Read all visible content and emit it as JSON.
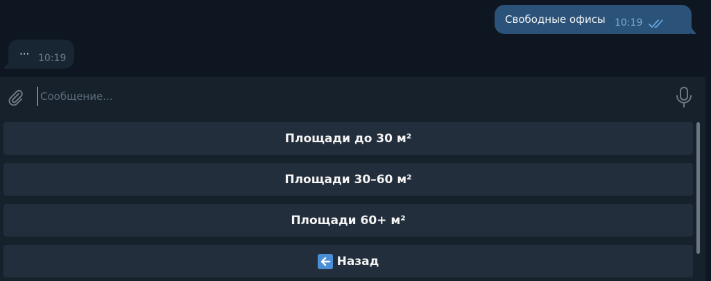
{
  "messages": {
    "outgoing": {
      "text": "Свободные офисы",
      "time": "10:19",
      "status_icon": "double-check-icon"
    },
    "incoming": {
      "text": "···",
      "time": "10:19"
    }
  },
  "composer": {
    "placeholder": "Сообщение...",
    "value": "",
    "attach_icon": "paperclip-icon",
    "mic_icon": "microphone-icon"
  },
  "keyboard": {
    "buttons": [
      {
        "label": "Площади до 30 м²"
      },
      {
        "label": "Площади 30–60 м²"
      },
      {
        "label": "Площади 60+ м²"
      },
      {
        "label": "Назад",
        "icon": "back-arrow-icon"
      }
    ]
  },
  "colors": {
    "background": "#0e1621",
    "outgoing_bubble": "#2b5278",
    "incoming_bubble": "#182533",
    "panel": "#17212b",
    "button": "#232e3c",
    "accent": "#4a8fd6"
  }
}
